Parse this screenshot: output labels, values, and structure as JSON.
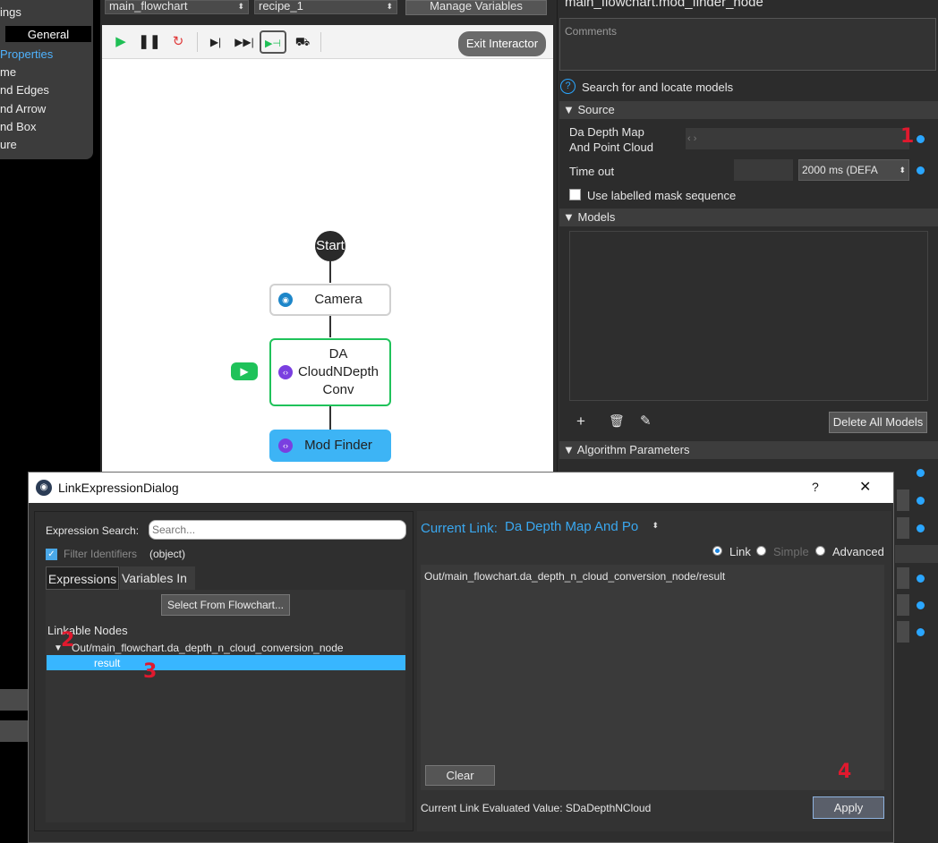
{
  "left_panel": {
    "items": [
      "ings",
      "General",
      "Properties",
      "me",
      "nd Edges",
      "nd Arrow",
      "nd Box",
      "ure"
    ]
  },
  "top_toolbar": {
    "flowchart_select": "main_flowchart",
    "recipe_select": "recipe_1",
    "manage_variables": "Manage Variables"
  },
  "canvas": {
    "exit_interactor": "Exit Interactor",
    "nodes": {
      "start": "Start",
      "camera": "Camera",
      "da_line1": "DA",
      "da_line2": "CloudNDepth",
      "da_line3": "Conv",
      "mod_finder": "Mod Finder"
    }
  },
  "right_panel": {
    "node_title": "main_flowchart.mod_finder_node",
    "comments_placeholder": "Comments",
    "help_text": "Search for and locate models",
    "source_header": "Source",
    "depth_map_label_1": "Da Depth Map",
    "depth_map_label_2": "And Point Cloud",
    "depth_map_value": "‹ ›",
    "timeout_label": "Time out",
    "timeout_value": "2000 ms (DEFA",
    "labelled_mask": "Use labelled mask sequence",
    "models_header": "Models",
    "delete_all_models": "Delete All Models",
    "algorithm_header": "Algorithm Parameters"
  },
  "dialog": {
    "title": "LinkExpressionDialog",
    "help": "?",
    "close": "✕",
    "expression_search_label": "Expression Search:",
    "search_placeholder": "Search...",
    "filter_identifiers": "Filter Identifiers",
    "filter_type": "(object)",
    "tab_expressions": "Expressions",
    "tab_variables": "Variables In",
    "select_from_flowchart": "Select From Flowchart...",
    "linkable_nodes": "Linkable Nodes",
    "tree_node": "Out/main_flowchart.da_depth_n_cloud_conversion_node",
    "tree_child": "result",
    "current_link_label": "Current Link:",
    "current_link_value": "Da Depth Map And Po",
    "radio_link": "Link",
    "radio_simple": "Simple",
    "radio_advanced": "Advanced",
    "expression_text": "Out/main_flowchart.da_depth_n_cloud_conversion_node/result",
    "clear": "Clear",
    "evaluated_value": "Current Link Evaluated Value: SDaDepthNCloud",
    "apply": "Apply"
  },
  "annotations": {
    "n1": "1",
    "n2": "2",
    "n3": "3",
    "n4": "4"
  },
  "colors": {
    "accent_blue": "#2aa6ff",
    "selection_blue": "#38b6ff",
    "node_green": "#1fc25a",
    "mod_finder_fill": "#3db4f5",
    "annotation_red": "#e0192e"
  }
}
